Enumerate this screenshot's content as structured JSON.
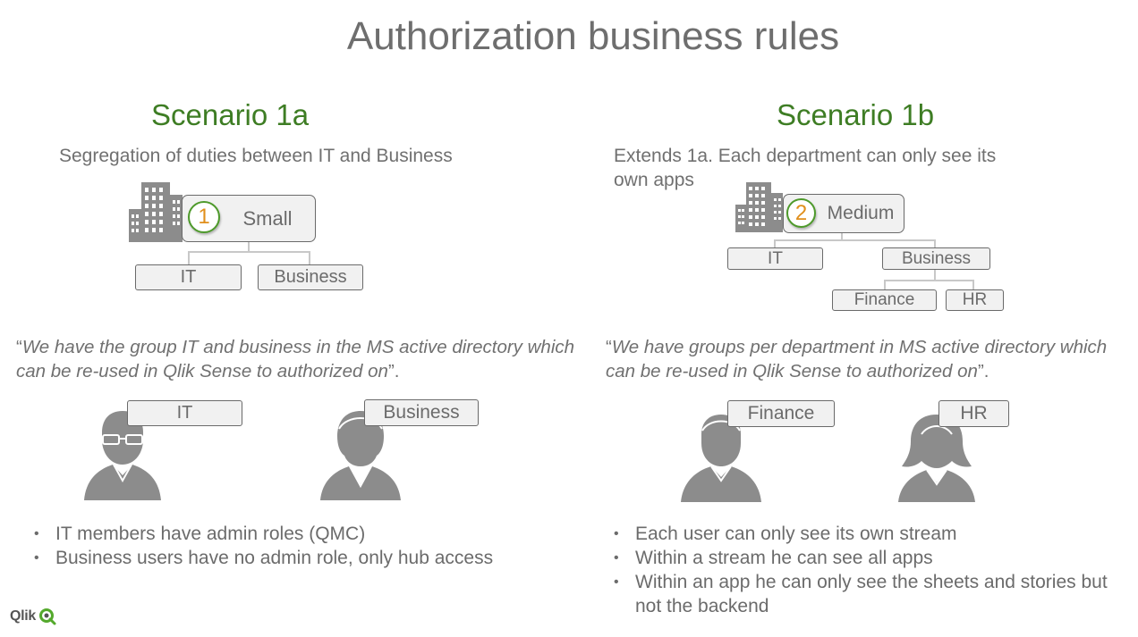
{
  "title": "Authorization business rules",
  "left": {
    "heading": "Scenario 1a",
    "subtitle": "Segregation of duties between IT and Business",
    "org": {
      "badge": "1",
      "label": "Small",
      "children": [
        "IT",
        "Business"
      ]
    },
    "quote": {
      "open": "“",
      "text": "We have the group IT and business in the MS active directory which can be re-used in Qlik Sense to authorized on",
      "close": "”."
    },
    "users": [
      "IT",
      "Business"
    ],
    "bullets": [
      "IT members have admin roles (QMC)",
      "Business users have no admin role, only hub access"
    ]
  },
  "right": {
    "heading": "Scenario 1b",
    "subtitle": "Extends 1a. Each department can only see its own apps",
    "org": {
      "badge": "2",
      "label": "Medium",
      "children": [
        "IT",
        "Business"
      ],
      "grandchildren": [
        "Finance",
        "HR"
      ]
    },
    "quote": {
      "open": "“",
      "text": "We have groups per department in MS active directory which can be re-used in Qlik Sense to authorized on",
      "close": "”."
    },
    "users": [
      "Finance",
      "HR"
    ],
    "bullets": [
      "Each user can only see its own stream",
      "Within a stream he can see all apps",
      "Within an app he can only see the sheets and stories but not the backend"
    ]
  },
  "logo": {
    "text": "Qlik",
    "icon": "qlik-q-icon"
  },
  "colors": {
    "green": "#3e7d24",
    "orange": "#e08f1c",
    "gray": "#6b6b6b",
    "iconGray": "#8c8c8c"
  }
}
